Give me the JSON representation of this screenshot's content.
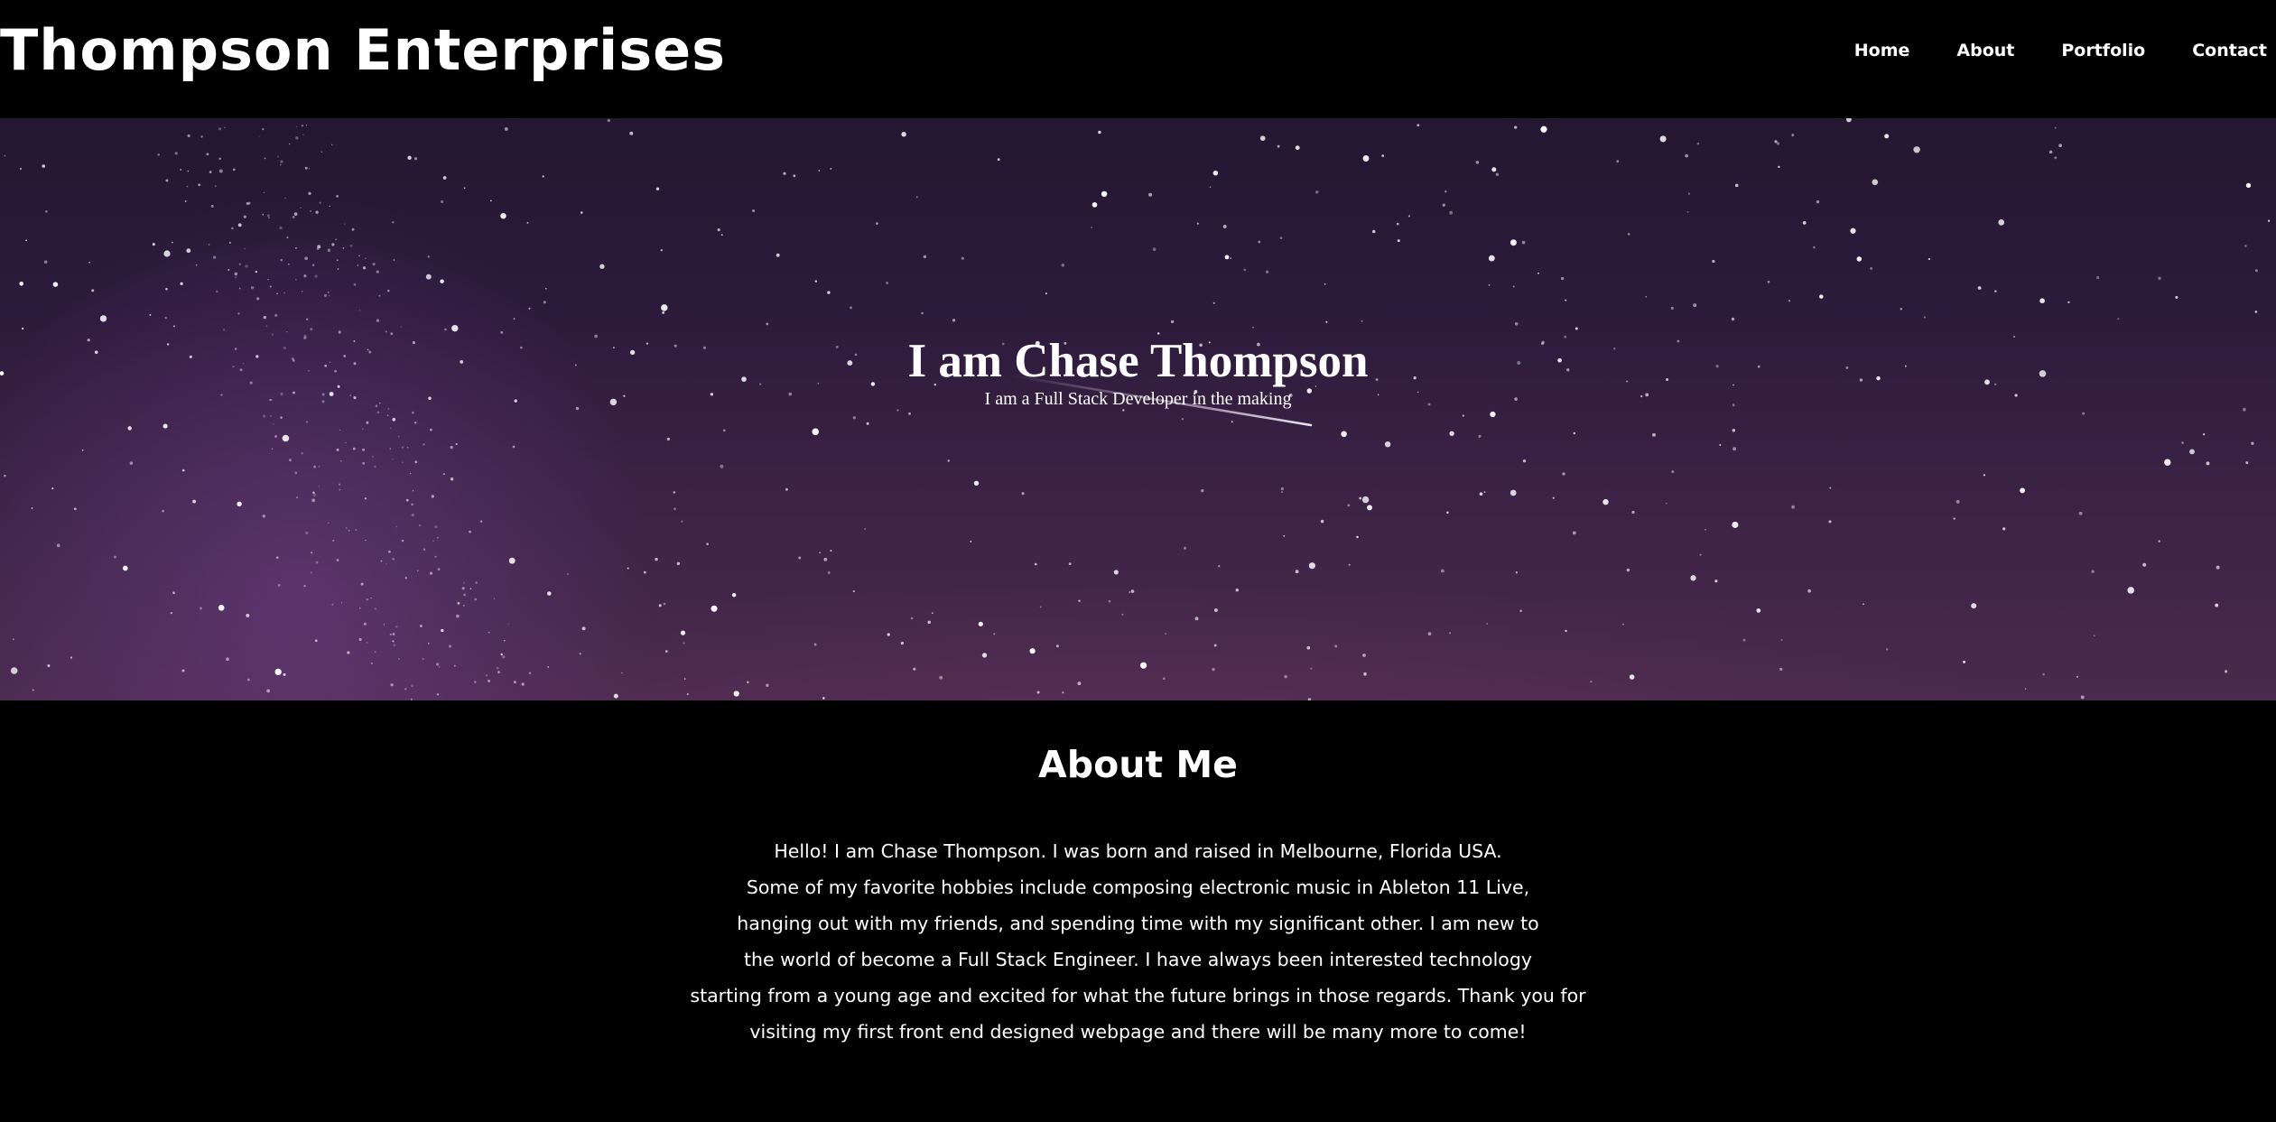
{
  "header": {
    "brand": "Thompson Enterprises",
    "nav": [
      {
        "label": "Home"
      },
      {
        "label": "About"
      },
      {
        "label": "Portfolio"
      },
      {
        "label": "Contact"
      }
    ]
  },
  "hero": {
    "title": "I am Chase Thompson",
    "subtitle": "I am a Full Stack Developer in the making",
    "background": "night-sky-milky-way-image"
  },
  "about": {
    "heading": "About Me",
    "lines": [
      "Hello! I am Chase Thompson. I was born and raised in Melbourne, Florida USA.",
      "Some of my favorite hobbies include composing electronic music in Ableton 11 Live,",
      "hanging out with my friends, and spending time with my significant other. I am new to",
      "the world of become a Full Stack Engineer. I have always been interested technology",
      "starting from a young age and excited for what the future brings in those regards. Thank you for",
      "visiting my first front end designed webpage and there will be many more to come!"
    ]
  },
  "colors": {
    "background": "#000000",
    "text": "#ffffff",
    "sky_top": "#241731",
    "sky_bottom": "#4a2a4d"
  }
}
